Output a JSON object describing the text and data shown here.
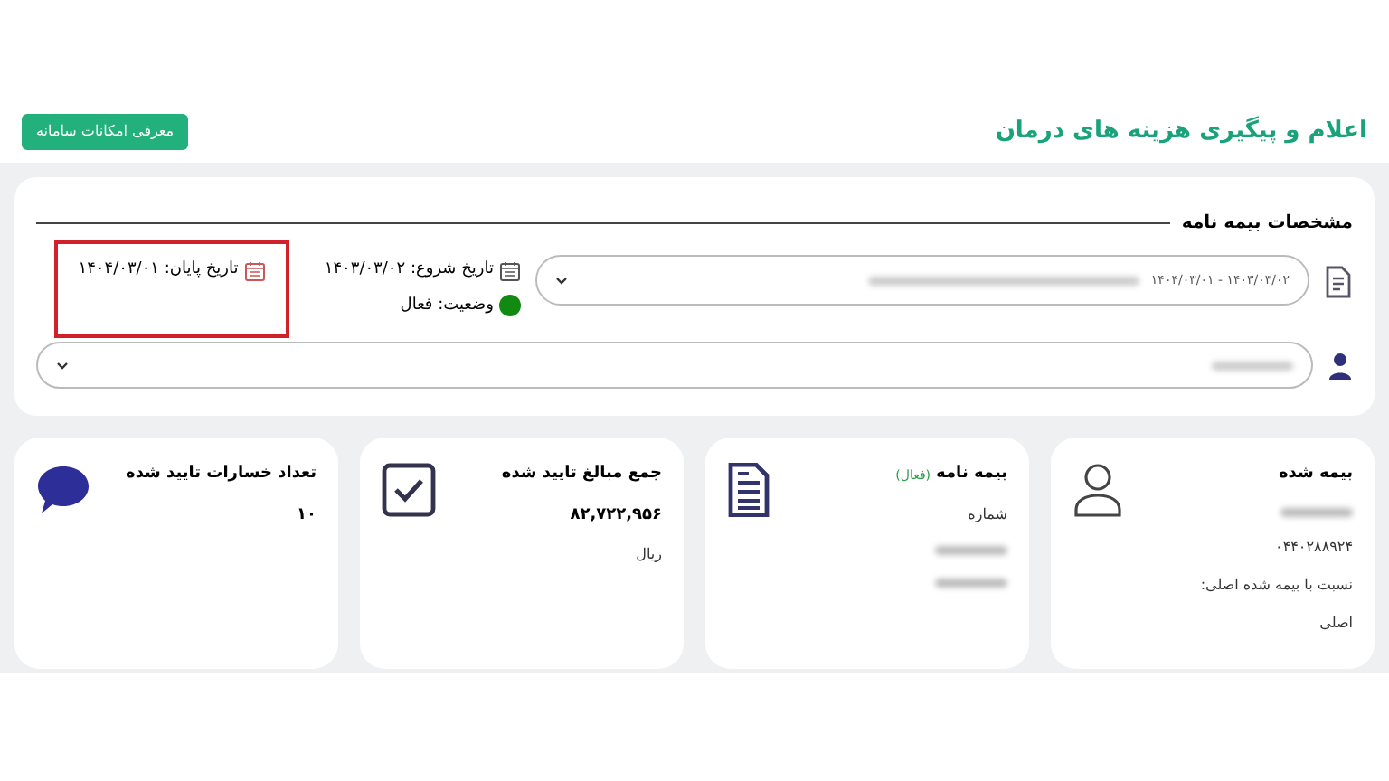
{
  "header": {
    "title": "اعلام و پیگیری هزینه های درمان",
    "button": "معرفی امکانات سامانه"
  },
  "policy_panel": {
    "title": "مشخصات بیمه نامه",
    "policy_select": {
      "value": "۱۴۰۳/۰۳/۰۲ - ۱۴۰۴/۰۳/۰۱"
    },
    "start_date": {
      "label": "تاریخ شروع:",
      "value": "۱۴۰۳/۰۳/۰۲"
    },
    "status": {
      "label": "وضعیت:",
      "value": "فعال",
      "active": true
    },
    "end_date": {
      "label": "تاریخ پایان:",
      "value": "۱۴۰۴/۰۳/۰۱",
      "highlighted": true
    }
  },
  "cards": [
    {
      "kind": "person",
      "title": "بیمه شده",
      "lines": [
        {
          "kind": "blurred"
        },
        {
          "kind": "text",
          "text": "۰۴۴۰۲۸۸۹۲۴"
        },
        {
          "kind": "text",
          "text": "نسبت با بیمه شده اصلی:"
        },
        {
          "kind": "text",
          "text": "اصلی"
        }
      ]
    },
    {
      "kind": "document",
      "title": "بیمه نامه",
      "badge": "(فعال)",
      "lines": [
        {
          "kind": "text",
          "text": "شماره"
        },
        {
          "kind": "blurred"
        },
        {
          "kind": "blurred"
        }
      ]
    },
    {
      "kind": "check",
      "title": "جمع مبالغ تایید شده",
      "lines": [
        {
          "kind": "value",
          "text": "۸۲,۷۲۲,۹۵۶"
        },
        {
          "kind": "text",
          "text": "ریال"
        }
      ]
    },
    {
      "kind": "chat",
      "title": "تعداد خسارات تایید شده",
      "lines": [
        {
          "kind": "value",
          "text": "۱۰"
        }
      ]
    }
  ]
}
